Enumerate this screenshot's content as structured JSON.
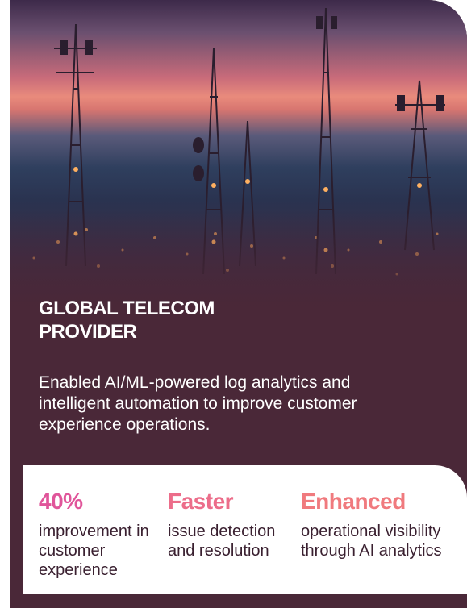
{
  "case": {
    "title_line1": "GLOBAL TELECOM",
    "title_line2": "PROVIDER",
    "description": "Enabled AI/ML-powered log analytics and intelligent automation to improve customer experience operations."
  },
  "stats": [
    {
      "value": "40%",
      "label": "improvement in customer experience"
    },
    {
      "value": "Faster",
      "label": "issue detection and resolution"
    },
    {
      "value": "Enhanced",
      "label": "operational visibility through AI analytics"
    }
  ],
  "colors": {
    "card_background": "#4a2838",
    "stat_accent_1": "#e0559a",
    "stat_accent_2": "#ec6d8a",
    "stat_accent_3": "#f07a7e"
  }
}
